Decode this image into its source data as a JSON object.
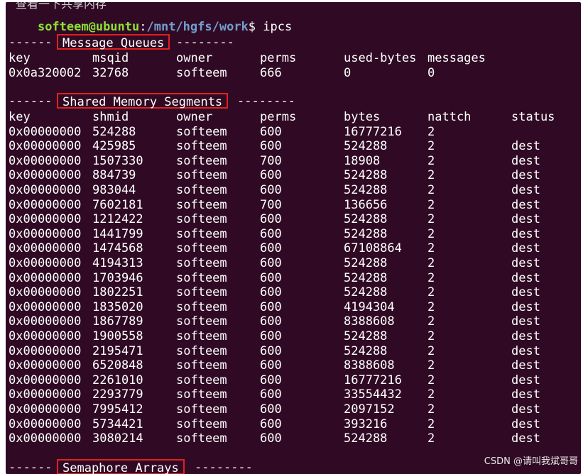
{
  "top_clipped_text": "查看一下共享内存",
  "prompt": {
    "user_host": "softeem@ubuntu",
    "separator": ":",
    "path": "/mnt/hgfs/work",
    "symbol": "$",
    "command": "ipcs"
  },
  "message_queues": {
    "dash_left": "------",
    "title": "Message Queues",
    "dash_right": "--------",
    "headers": [
      "key",
      "msqid",
      "owner",
      "perms",
      "used-bytes",
      "messages"
    ],
    "rows": [
      [
        "0x0a320002",
        "32768",
        "softeem",
        "666",
        "0",
        "0"
      ]
    ]
  },
  "shared_memory": {
    "dash_left": "------",
    "title": "Shared Memory Segments",
    "dash_right": "--------",
    "headers": [
      "key",
      "shmid",
      "owner",
      "perms",
      "bytes",
      "nattch",
      "status"
    ],
    "rows": [
      [
        "0x00000000",
        "524288",
        "softeem",
        "600",
        "16777216",
        "2",
        ""
      ],
      [
        "0x00000000",
        "425985",
        "softeem",
        "600",
        "524288",
        "2",
        "dest"
      ],
      [
        "0x00000000",
        "1507330",
        "softeem",
        "700",
        "18908",
        "2",
        "dest"
      ],
      [
        "0x00000000",
        "884739",
        "softeem",
        "600",
        "524288",
        "2",
        "dest"
      ],
      [
        "0x00000000",
        "983044",
        "softeem",
        "600",
        "524288",
        "2",
        "dest"
      ],
      [
        "0x00000000",
        "7602181",
        "softeem",
        "700",
        "136656",
        "2",
        "dest"
      ],
      [
        "0x00000000",
        "1212422",
        "softeem",
        "600",
        "524288",
        "2",
        "dest"
      ],
      [
        "0x00000000",
        "1441799",
        "softeem",
        "600",
        "524288",
        "2",
        "dest"
      ],
      [
        "0x00000000",
        "1474568",
        "softeem",
        "600",
        "67108864",
        "2",
        "dest"
      ],
      [
        "0x00000000",
        "4194313",
        "softeem",
        "600",
        "524288",
        "2",
        "dest"
      ],
      [
        "0x00000000",
        "1703946",
        "softeem",
        "600",
        "524288",
        "2",
        "dest"
      ],
      [
        "0x00000000",
        "1802251",
        "softeem",
        "600",
        "524288",
        "2",
        "dest"
      ],
      [
        "0x00000000",
        "1835020",
        "softeem",
        "600",
        "4194304",
        "2",
        "dest"
      ],
      [
        "0x00000000",
        "1867789",
        "softeem",
        "600",
        "8388608",
        "2",
        "dest"
      ],
      [
        "0x00000000",
        "1900558",
        "softeem",
        "600",
        "524288",
        "2",
        "dest"
      ],
      [
        "0x00000000",
        "2195471",
        "softeem",
        "600",
        "524288",
        "2",
        "dest"
      ],
      [
        "0x00000000",
        "6520848",
        "softeem",
        "600",
        "8388608",
        "2",
        "dest"
      ],
      [
        "0x00000000",
        "2261010",
        "softeem",
        "600",
        "16777216",
        "2",
        "dest"
      ],
      [
        "0x00000000",
        "2293779",
        "softeem",
        "600",
        "33554432",
        "2",
        "dest"
      ],
      [
        "0x00000000",
        "7995412",
        "softeem",
        "600",
        "2097152",
        "2",
        "dest"
      ],
      [
        "0x00000000",
        "5734421",
        "softeem",
        "600",
        "393216",
        "2",
        "dest"
      ],
      [
        "0x00000000",
        "3080214",
        "softeem",
        "600",
        "524288",
        "2",
        "dest"
      ]
    ]
  },
  "semaphore_arrays": {
    "dash_left": "------",
    "title": "Semaphore Arrays",
    "dash_right": "--------"
  },
  "watermark": "CSDN @请叫我斌哥哥",
  "colors": {
    "terminal_bg": "#300a24",
    "text": "#ffffff",
    "prompt_user": "#8ae234",
    "prompt_path": "#729fcf",
    "highlight_box": "#e02020"
  }
}
